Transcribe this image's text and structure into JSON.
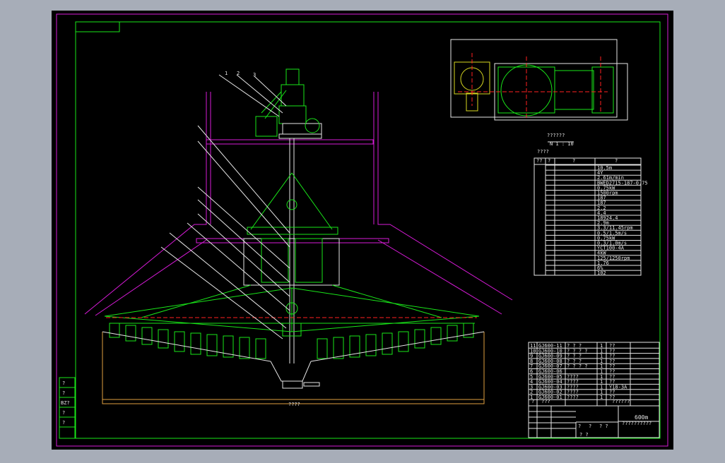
{
  "drawing": {
    "scale_note": "N 1 : 10",
    "spec_title": "????",
    "detail_title": "??????",
    "main_title": "??????????",
    "subtitle": "600m",
    "spec_header": [
      "??",
      "?",
      "?",
      "?"
    ],
    "spec_values": [
      "10.5m",
      "4Y",
      "2.61m/min",
      "BWED2715-187-0.75",
      "0.75kW",
      "1500rpm",
      "187",
      "187",
      "2.2",
      "4.4",
      "18924.4",
      "2.9m",
      "3.3/11.45rpm",
      "0.5/1.5m/s",
      "0.75kW",
      "0.3/1.0m/s",
      "YCT100-4A",
      "4kW",
      "125/1250rpm",
      "1.76",
      "6%",
      "102"
    ],
    "parts": [
      {
        "no": "11",
        "code": "GJ600-11",
        "name": "? ? ?",
        "qty": "1",
        "mat": "??"
      },
      {
        "no": "10",
        "code": "GJ600-10",
        "name": "? ? ? ?",
        "qty": "1",
        "mat": "??"
      },
      {
        "no": "9",
        "code": "GJ600-09",
        "name": "? ? ?",
        "qty": "1",
        "mat": "??"
      },
      {
        "no": "8",
        "code": "GJ600-08",
        "name": "? ? ?",
        "qty": "1",
        "mat": "??"
      },
      {
        "no": "7",
        "code": "GJ600-07",
        "name": "? ? ? ?",
        "qty": "1",
        "mat": "??"
      },
      {
        "no": "6",
        "code": "GJ600-06",
        "name": "",
        "qty": "1",
        "mat": "??"
      },
      {
        "no": "5",
        "code": "GJ600-05",
        "name": "????",
        "qty": "1",
        "mat": "??"
      },
      {
        "no": "4",
        "code": "GJ600-04",
        "name": "????",
        "qty": "1",
        "mat": "??"
      },
      {
        "no": "3",
        "code": "GJ600-03",
        "name": "????",
        "qty": "1",
        "mat": "Y18-3A"
      },
      {
        "no": "2",
        "code": "GJ600-02",
        "name": "????",
        "qty": "1",
        "mat": "??"
      },
      {
        "no": "1",
        "code": "GJ600-01",
        "name": "????",
        "qty": "1",
        "mat": "??"
      }
    ],
    "parts_footer": [
      "?",
      "???",
      "??????",
      "?"
    ],
    "title_block_marks": [
      "?",
      "?",
      "? ?",
      "? ?"
    ],
    "leader_numbers": [
      "1",
      "2",
      "3",
      "4",
      "5",
      "6",
      "7",
      "8",
      "9",
      "10",
      "11"
    ],
    "dim_overall": "????",
    "left_strip": [
      "?",
      "?",
      "?",
      "BZ?",
      "?",
      "?"
    ]
  }
}
